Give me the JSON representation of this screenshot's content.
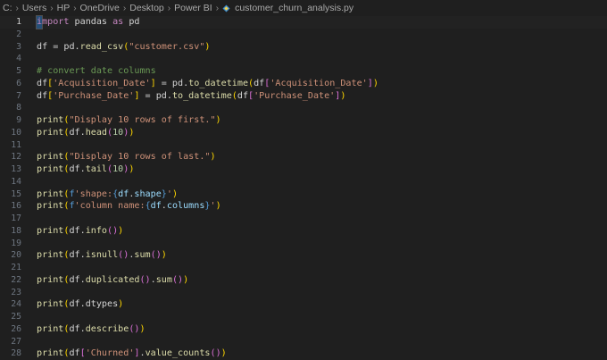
{
  "breadcrumb": {
    "items": [
      "C:",
      "Users",
      "HP",
      "OneDrive",
      "Desktop",
      "Power BI"
    ],
    "file": "customer_churn_analysis.py"
  },
  "active_line": 1,
  "lines": [
    {
      "n": "1",
      "tokens": [
        [
          "cursor",
          "i"
        ],
        [
          "kw",
          "mport"
        ],
        [
          "id",
          " pandas "
        ],
        [
          "kw",
          "as"
        ],
        [
          "id",
          " pd"
        ]
      ]
    },
    {
      "n": "2",
      "tokens": []
    },
    {
      "n": "3",
      "tokens": [
        [
          "id",
          "df = pd."
        ],
        [
          "fn",
          "read_csv"
        ],
        [
          "p1",
          "("
        ],
        [
          "str",
          "\"customer.csv\""
        ],
        [
          "p1",
          ")"
        ]
      ]
    },
    {
      "n": "4",
      "tokens": []
    },
    {
      "n": "5",
      "tokens": [
        [
          "cmt",
          "# convert date columns"
        ]
      ]
    },
    {
      "n": "6",
      "tokens": [
        [
          "id",
          "df"
        ],
        [
          "p1",
          "["
        ],
        [
          "str",
          "'Acquisition_Date'"
        ],
        [
          "p1",
          "]"
        ],
        [
          "id",
          " = pd."
        ],
        [
          "fn",
          "to_datetime"
        ],
        [
          "p1",
          "("
        ],
        [
          "id",
          "df"
        ],
        [
          "p2",
          "["
        ],
        [
          "str",
          "'Acquisition_Date'"
        ],
        [
          "p2",
          "]"
        ],
        [
          "p1",
          ")"
        ]
      ]
    },
    {
      "n": "7",
      "tokens": [
        [
          "id",
          "df"
        ],
        [
          "p1",
          "["
        ],
        [
          "str",
          "'Purchase_Date'"
        ],
        [
          "p1",
          "]"
        ],
        [
          "id",
          " = pd."
        ],
        [
          "fn",
          "to_datetime"
        ],
        [
          "p1",
          "("
        ],
        [
          "id",
          "df"
        ],
        [
          "p2",
          "["
        ],
        [
          "str",
          "'Purchase_Date'"
        ],
        [
          "p2",
          "]"
        ],
        [
          "p1",
          ")"
        ]
      ]
    },
    {
      "n": "8",
      "tokens": []
    },
    {
      "n": "9",
      "tokens": [
        [
          "fn",
          "print"
        ],
        [
          "p1",
          "("
        ],
        [
          "str",
          "\"Display 10 rows of first.\""
        ],
        [
          "p1",
          ")"
        ]
      ]
    },
    {
      "n": "10",
      "tokens": [
        [
          "fn",
          "print"
        ],
        [
          "p1",
          "("
        ],
        [
          "id",
          "df."
        ],
        [
          "fn",
          "head"
        ],
        [
          "p2",
          "("
        ],
        [
          "num",
          "10"
        ],
        [
          "p2",
          ")"
        ],
        [
          "p1",
          ")"
        ]
      ]
    },
    {
      "n": "11",
      "tokens": []
    },
    {
      "n": "12",
      "tokens": [
        [
          "fn",
          "print"
        ],
        [
          "p1",
          "("
        ],
        [
          "str",
          "\"Display 10 rows of last.\""
        ],
        [
          "p1",
          ")"
        ]
      ]
    },
    {
      "n": "13",
      "tokens": [
        [
          "fn",
          "print"
        ],
        [
          "p1",
          "("
        ],
        [
          "id",
          "df."
        ],
        [
          "fn",
          "tail"
        ],
        [
          "p2",
          "("
        ],
        [
          "num",
          "10"
        ],
        [
          "p2",
          ")"
        ],
        [
          "p1",
          ")"
        ]
      ]
    },
    {
      "n": "14",
      "tokens": []
    },
    {
      "n": "15",
      "tokens": [
        [
          "fn",
          "print"
        ],
        [
          "p1",
          "("
        ],
        [
          "fbr",
          "f"
        ],
        [
          "str",
          "'shape:"
        ],
        [
          "fbr",
          "{"
        ],
        [
          "var",
          "df"
        ],
        [
          "id",
          "."
        ],
        [
          "var",
          "shape"
        ],
        [
          "fbr",
          "}"
        ],
        [
          "str",
          "'"
        ],
        [
          "p1",
          ")"
        ]
      ]
    },
    {
      "n": "16",
      "tokens": [
        [
          "fn",
          "print"
        ],
        [
          "p1",
          "("
        ],
        [
          "fbr",
          "f"
        ],
        [
          "str",
          "'column name:"
        ],
        [
          "fbr",
          "{"
        ],
        [
          "var",
          "df"
        ],
        [
          "id",
          "."
        ],
        [
          "var",
          "columns"
        ],
        [
          "fbr",
          "}"
        ],
        [
          "str",
          "'"
        ],
        [
          "p1",
          ")"
        ]
      ]
    },
    {
      "n": "17",
      "tokens": []
    },
    {
      "n": "18",
      "tokens": [
        [
          "fn",
          "print"
        ],
        [
          "p1",
          "("
        ],
        [
          "id",
          "df."
        ],
        [
          "fn",
          "info"
        ],
        [
          "p2",
          "()"
        ],
        [
          "p1",
          ")"
        ]
      ]
    },
    {
      "n": "19",
      "tokens": []
    },
    {
      "n": "20",
      "tokens": [
        [
          "fn",
          "print"
        ],
        [
          "p1",
          "("
        ],
        [
          "id",
          "df."
        ],
        [
          "fn",
          "isnull"
        ],
        [
          "p2",
          "()"
        ],
        [
          "id",
          "."
        ],
        [
          "fn",
          "sum"
        ],
        [
          "p2",
          "()"
        ],
        [
          "p1",
          ")"
        ]
      ]
    },
    {
      "n": "21",
      "tokens": []
    },
    {
      "n": "22",
      "tokens": [
        [
          "fn",
          "print"
        ],
        [
          "p1",
          "("
        ],
        [
          "id",
          "df."
        ],
        [
          "fn",
          "duplicated"
        ],
        [
          "p2",
          "()"
        ],
        [
          "id",
          "."
        ],
        [
          "fn",
          "sum"
        ],
        [
          "p2",
          "()"
        ],
        [
          "p1",
          ")"
        ]
      ]
    },
    {
      "n": "23",
      "tokens": []
    },
    {
      "n": "24",
      "tokens": [
        [
          "fn",
          "print"
        ],
        [
          "p1",
          "("
        ],
        [
          "id",
          "df.dtypes"
        ],
        [
          "p1",
          ")"
        ]
      ]
    },
    {
      "n": "25",
      "tokens": []
    },
    {
      "n": "26",
      "tokens": [
        [
          "fn",
          "print"
        ],
        [
          "p1",
          "("
        ],
        [
          "id",
          "df."
        ],
        [
          "fn",
          "describe"
        ],
        [
          "p2",
          "()"
        ],
        [
          "p1",
          ")"
        ]
      ]
    },
    {
      "n": "27",
      "tokens": []
    },
    {
      "n": "28",
      "tokens": [
        [
          "fn",
          "print"
        ],
        [
          "p1",
          "("
        ],
        [
          "id",
          "df"
        ],
        [
          "p2",
          "["
        ],
        [
          "str",
          "'Churned'"
        ],
        [
          "p2",
          "]"
        ],
        [
          "id",
          "."
        ],
        [
          "fn",
          "value_counts"
        ],
        [
          "p2",
          "()"
        ],
        [
          "p1",
          ")"
        ]
      ]
    }
  ]
}
